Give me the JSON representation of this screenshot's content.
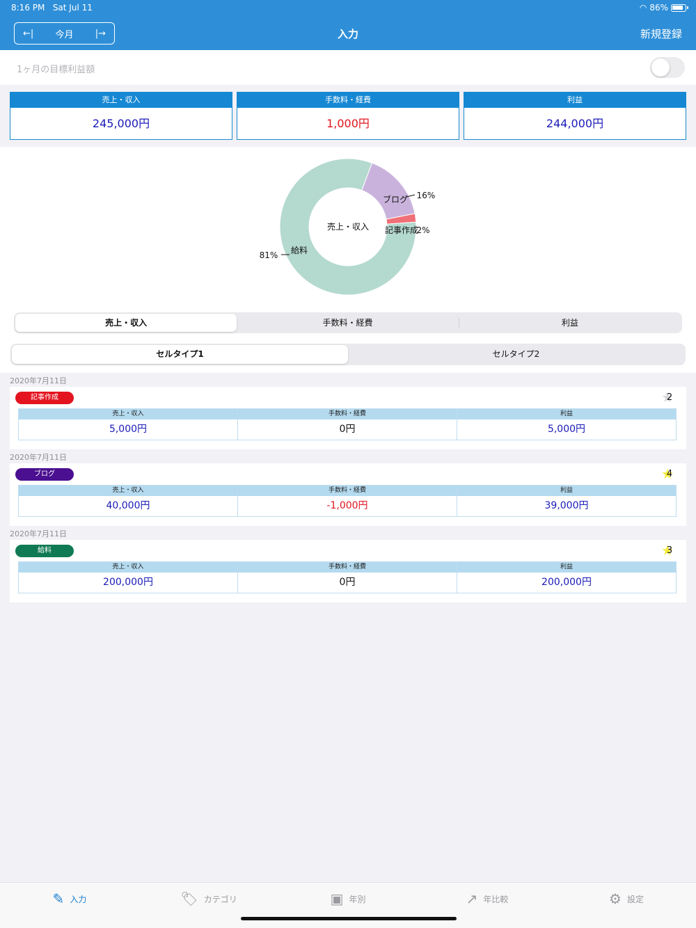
{
  "status": {
    "time": "8:16 PM",
    "date": "Sat Jul 11",
    "battery": "86%"
  },
  "nav": {
    "prev": "←|",
    "month": "今月",
    "next": "|→",
    "title": "入力",
    "new_label": "新規登録"
  },
  "target": {
    "label": "1ヶ月の目標利益額"
  },
  "summary": [
    {
      "label": "売上・収入",
      "value": "245,000円",
      "color": "#1a1ab8"
    },
    {
      "label": "手数料・経費",
      "value": "1,000円",
      "color": "#e0141e"
    },
    {
      "label": "利益",
      "value": "244,000円",
      "color": "#1a1ab8"
    }
  ],
  "chart_data": {
    "type": "pie",
    "center_label": "売上・収入",
    "slices": [
      {
        "label": "給料",
        "value": 81,
        "pct_label": "81%",
        "color": "#b4d9cf"
      },
      {
        "label": "ブログ",
        "value": 16,
        "pct_label": "16%",
        "color": "#c9b3dc"
      },
      {
        "label": "記事作成",
        "value": 2,
        "pct_label": "2%",
        "color": "#f07077"
      }
    ]
  },
  "segments1": {
    "items": [
      "売上・収入",
      "手数料・経費",
      "利益"
    ],
    "active": 0
  },
  "segments2": {
    "items": [
      "セルタイプ1",
      "セルタイプ2"
    ],
    "active": 0
  },
  "columns": {
    "sales": "売上・収入",
    "fees": "手数料・経費",
    "profit": "利益"
  },
  "entries": [
    {
      "date": "2020年7月11日",
      "tag": "記事作成",
      "tag_color": "#e4141f",
      "badge": "2",
      "badge_star": false,
      "sales": "5,000円",
      "fees": "0円",
      "profit": "5,000円",
      "fees_color": "#111111"
    },
    {
      "date": "2020年7月11日",
      "tag": "ブログ",
      "tag_color": "#4b0f91",
      "badge": "4",
      "badge_star": true,
      "sales": "40,000円",
      "fees": "-1,000円",
      "profit": "39,000円",
      "fees_color": "#e0141e"
    },
    {
      "date": "2020年7月11日",
      "tag": "給料",
      "tag_color": "#0f7a54",
      "badge": "3",
      "badge_star": true,
      "sales": "200,000円",
      "fees": "0円",
      "profit": "200,000円",
      "fees_color": "#111111"
    }
  ],
  "tabs": [
    {
      "label": "入力",
      "icon": "pencil-icon",
      "glyph": "✎",
      "active": true
    },
    {
      "label": "カテゴリ",
      "icon": "tag-icon",
      "glyph": "🏷",
      "active": false
    },
    {
      "label": "年別",
      "icon": "briefcase-icon",
      "glyph": "▣",
      "active": false
    },
    {
      "label": "年比較",
      "icon": "arrow-up-right-icon",
      "glyph": "↗",
      "active": false
    },
    {
      "label": "設定",
      "icon": "gear-icon",
      "glyph": "⚙",
      "active": false
    }
  ]
}
